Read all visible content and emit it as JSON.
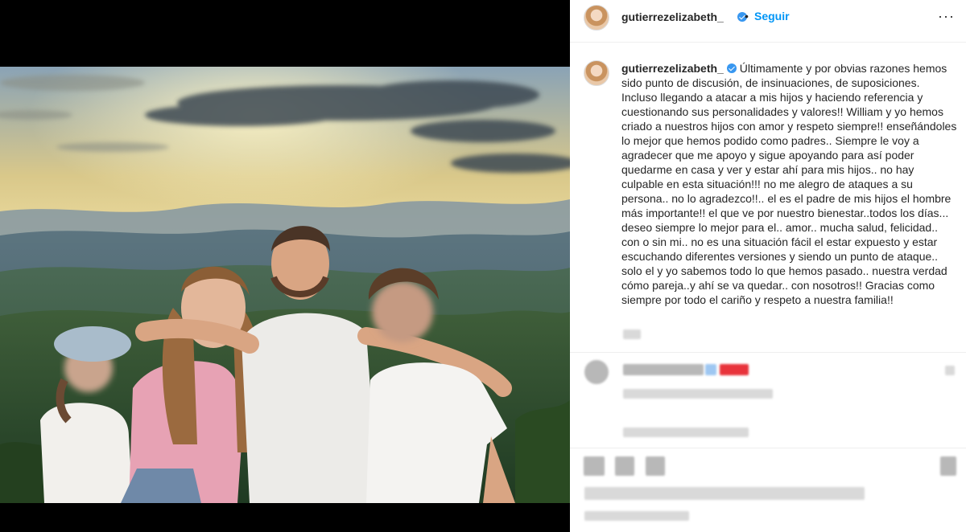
{
  "post": {
    "username": "gutierrezelizabeth_",
    "dot": "•",
    "follow_label": "Seguir",
    "more_label": "···",
    "caption": "Últimamente y por obvias razones hemos sido punto de discusión, de insinuaciones, de suposiciones. Incluso llegando a atacar a mis hijos y haciendo referencia y cuestionando sus personalidades y valores!! William y yo hemos criado a nuestros hijos con amor y respeto siempre!! enseñándoles lo mejor que hemos podido como padres.. Siempre le voy a agradecer que me apoyo y sigue apoyando para así poder quedarme en casa y ver y estar ahí para mis hijos.. no hay culpable en esta situación!!! no me alegro de ataques a su persona.. no lo agradezco!!.. el es el padre de mis hijos el hombre más importante!! el que ve por nuestro bienestar..todos los días... deseo siempre lo mejor para el.. amor.. mucha salud, felicidad.. con o sin mi.. no es una situación fácil el estar expuesto y estar escuchando diferentes versiones y siendo un punto de ataque.. solo el y yo sabemos todo lo que hemos pasado.. nuestra verdad cómo pareja..y ahí se va quedar.. con nosotros!! Gracias como siempre por todo el cariño y respeto a nuestra familia!!"
  },
  "colors": {
    "accent": "#0095f6",
    "verified": "#3897f0",
    "text": "#262626"
  },
  "icons": [
    "verified-badge-icon",
    "more-options-icon"
  ]
}
